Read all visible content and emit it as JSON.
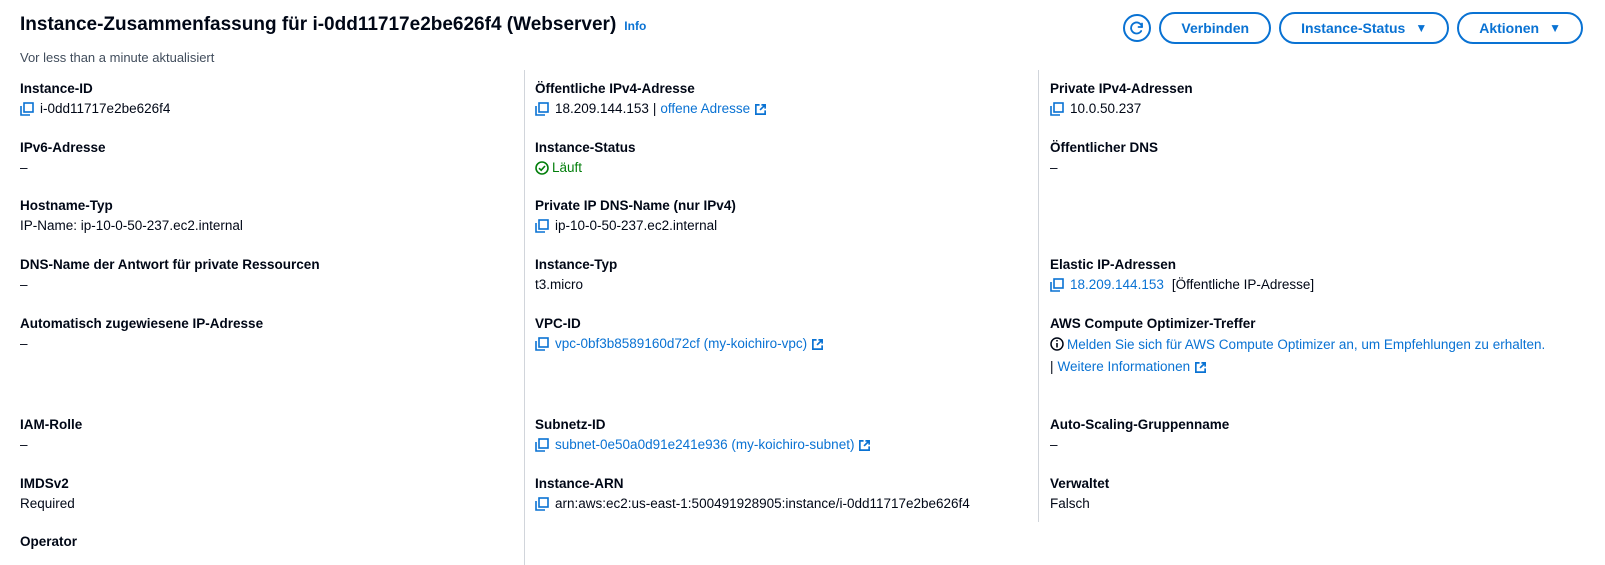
{
  "header": {
    "title": "Instance-Zusammenfassung für i-0dd11717e2be626f4 (Webserver)",
    "info": "Info",
    "updated": "Vor less than a minute aktualisiert"
  },
  "actions": {
    "connect": "Verbinden",
    "instance_state": "Instance-Status",
    "actions": "Aktionen"
  },
  "col1": {
    "instance_id": {
      "label": "Instance-ID",
      "value": "i-0dd11717e2be626f4"
    },
    "ipv6": {
      "label": "IPv6-Adresse",
      "value": "–"
    },
    "hostname_type": {
      "label": "Hostname-Typ",
      "value": "IP-Name: ip-10-0-50-237.ec2.internal"
    },
    "dns_answer": {
      "label": "DNS-Name der Antwort für private Ressourcen",
      "value": "–"
    },
    "auto_ip": {
      "label": "Automatisch zugewiesene IP-Adresse",
      "value": "–"
    },
    "iam_role": {
      "label": "IAM-Rolle",
      "value": "–"
    },
    "imdsv2": {
      "label": "IMDSv2",
      "value": "Required"
    },
    "operator": {
      "label": "Operator"
    }
  },
  "col2": {
    "public_ipv4": {
      "label": "Öffentliche IPv4-Adresse",
      "value": "18.209.144.153",
      "sep": "|",
      "link": "offene Adresse"
    },
    "instance_state": {
      "label": "Instance-Status",
      "value": "Läuft"
    },
    "private_dns": {
      "label": "Private IP DNS-Name (nur IPv4)",
      "value": "ip-10-0-50-237.ec2.internal"
    },
    "instance_type": {
      "label": "Instance-Typ",
      "value": "t3.micro"
    },
    "vpc": {
      "label": "VPC-ID",
      "value": "vpc-0bf3b8589160d72cf (my-koichiro-vpc)"
    },
    "subnet": {
      "label": "Subnetz-ID",
      "value": "subnet-0e50a0d91e241e936 (my-koichiro-subnet)"
    },
    "arn": {
      "label": "Instance-ARN",
      "value": "arn:aws:ec2:us-east-1:500491928905:instance/i-0dd11717e2be626f4"
    }
  },
  "col3": {
    "private_ipv4": {
      "label": "Private IPv4-Adressen",
      "value": "10.0.50.237"
    },
    "public_dns": {
      "label": "Öffentlicher DNS",
      "value": "–"
    },
    "elastic_ip": {
      "label": "Elastic IP-Adressen",
      "value": "18.209.144.153",
      "suffix": "[Öffentliche IP-Adresse]"
    },
    "optimizer": {
      "label": "AWS Compute Optimizer-Treffer",
      "text": "Melden Sie sich für AWS Compute Optimizer an, um Empfehlungen zu erhalten.",
      "sep": "|",
      "more": "Weitere Informationen"
    },
    "asg": {
      "label": "Auto-Scaling-Gruppenname",
      "value": "–"
    },
    "managed": {
      "label": "Verwaltet",
      "value": "Falsch"
    }
  },
  "colors": {
    "link": "#0972d3",
    "success": "#037f0c",
    "text": "#000716"
  }
}
